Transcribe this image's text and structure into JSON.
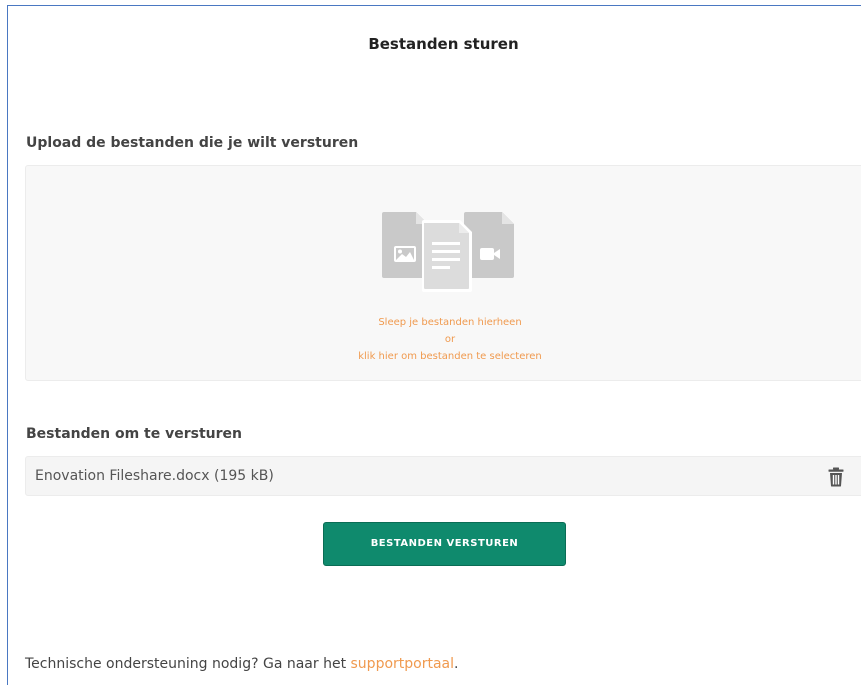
{
  "page": {
    "title": "Bestanden sturen"
  },
  "upload": {
    "label": "Upload de bestanden die je wilt versturen",
    "dropzone": {
      "line1": "Sleep je bestanden hierheen",
      "line2": "or",
      "line3": "klik hier om bestanden te selecteren",
      "icons": [
        "image-file-icon",
        "document-file-icon",
        "video-file-icon"
      ]
    }
  },
  "files": {
    "label": "Bestanden om te versturen",
    "items": [
      {
        "name": "Enovation Fileshare.docx (195 kB)",
        "action_icon": "trash-icon"
      }
    ]
  },
  "actions": {
    "send_label": "BESTANDEN VERSTUREN"
  },
  "footer": {
    "text": "Technische ondersteuning nodig? Ga naar het ",
    "link_text": "supportportaal",
    "suffix": "."
  },
  "colors": {
    "accent_orange": "#f09a4f",
    "button_green": "#0f8a6d",
    "frame_blue": "#4a78c2",
    "icon_gray": "#c9c9c9"
  }
}
